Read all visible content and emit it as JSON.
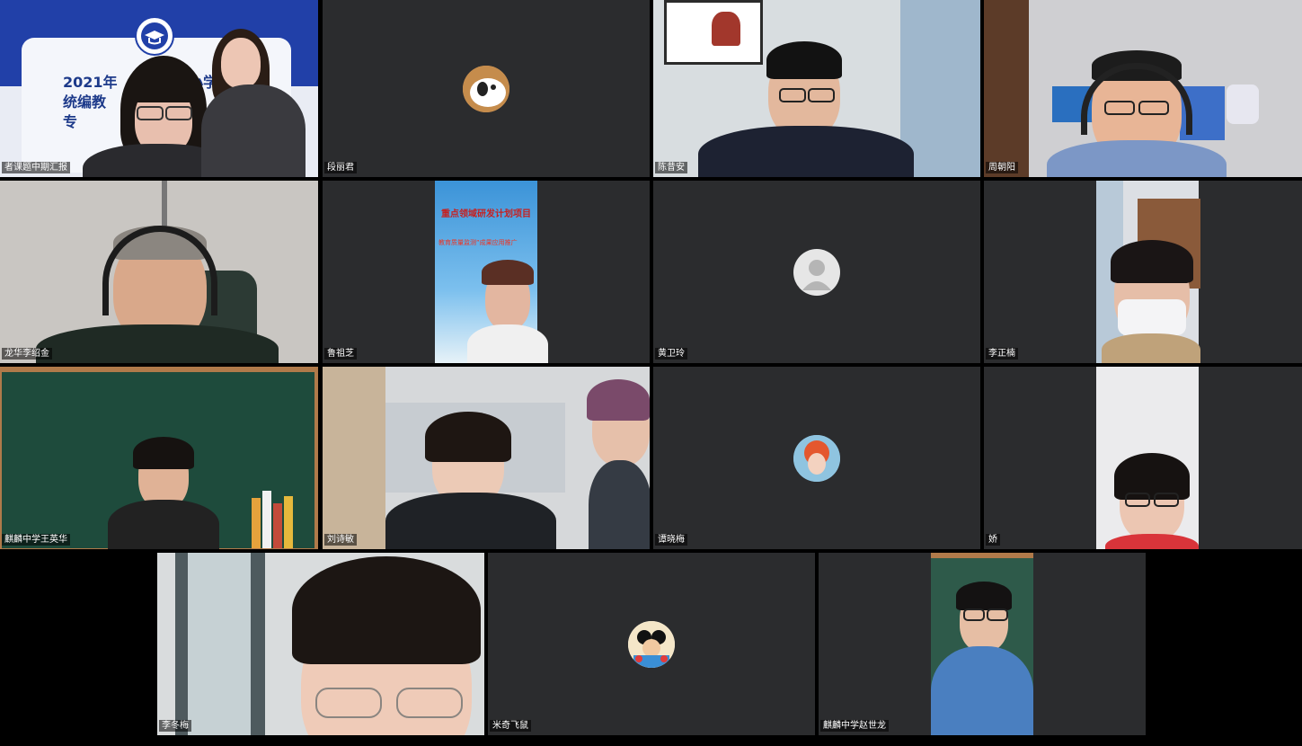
{
  "participants": [
    {
      "name": "者课题中期汇报"
    },
    {
      "name": "段丽君"
    },
    {
      "name": "陈昔安"
    },
    {
      "name": "周朝阳"
    },
    {
      "name": "龙华李绍金"
    },
    {
      "name": "鲁祖芝"
    },
    {
      "name": "黄卫玲"
    },
    {
      "name": "李正楠"
    },
    {
      "name": "麒麟中学王英华"
    },
    {
      "name": "刘诗敏"
    },
    {
      "name": "谭晓梅"
    },
    {
      "name": "娇"
    },
    {
      "name": "李冬梅"
    },
    {
      "name": "米奇飞鼠"
    },
    {
      "name": "麒麟中学赵世龙"
    }
  ],
  "slide": {
    "line1": "2021年",
    "line1b": "小学",
    "line2": "统编教",
    "line3": "专"
  },
  "poster": {
    "banner": "重点领域研发计划项目",
    "subtitle": "教育质量监测”成果应用推广"
  },
  "colors": {
    "tile_bg": "#2b2c2e",
    "page_bg": "#000000",
    "slide_blue": "#1d3a8a"
  }
}
